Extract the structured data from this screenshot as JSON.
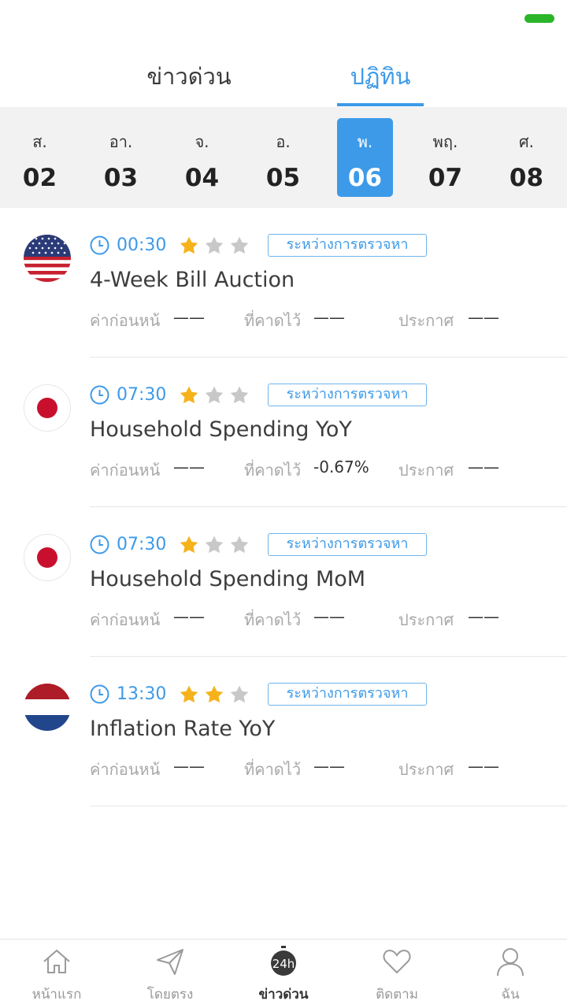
{
  "tabs": [
    {
      "label": "ข่าวด่วน",
      "active": false
    },
    {
      "label": "ปฏิทิน",
      "active": true
    }
  ],
  "days": [
    {
      "dow": "ส.",
      "num": "02"
    },
    {
      "dow": "อา.",
      "num": "03"
    },
    {
      "dow": "จ.",
      "num": "04"
    },
    {
      "dow": "อ.",
      "num": "05"
    },
    {
      "dow": "พ.",
      "num": "06",
      "active": true
    },
    {
      "dow": "พฤ.",
      "num": "07"
    },
    {
      "dow": "ศ.",
      "num": "08"
    }
  ],
  "labels": {
    "previous": "ค่าก่อนหน้",
    "forecast": "ที่คาดไว้",
    "actual": "ประกาศ"
  },
  "events": [
    {
      "flag": "us-flag-icon",
      "time": "00:30",
      "importance": 1,
      "status": "ระหว่างการตรวจหา",
      "title": "4-Week Bill Auction",
      "previous": "——",
      "forecast": "——",
      "actual": "——"
    },
    {
      "flag": "japan-flag-icon",
      "time": "07:30",
      "importance": 1,
      "status": "ระหว่างการตรวจหา",
      "title": "Household Spending YoY",
      "previous": "——",
      "forecast": "-0.67%",
      "actual": "——"
    },
    {
      "flag": "japan-flag-icon",
      "time": "07:30",
      "importance": 1,
      "status": "ระหว่างการตรวจหา",
      "title": "Household Spending MoM",
      "previous": "——",
      "forecast": "——",
      "actual": "——"
    },
    {
      "flag": "netherlands-flag-icon",
      "time": "13:30",
      "importance": 2,
      "status": "ระหว่างการตรวจหา",
      "title": "Inflation Rate YoY",
      "previous": "——",
      "forecast": "——",
      "actual": "——"
    }
  ],
  "bottom_nav": [
    {
      "label": "หน้าแรก",
      "icon": "home-icon"
    },
    {
      "label": "โดยตรง",
      "icon": "send-icon"
    },
    {
      "label": "ข่าวด่วน",
      "icon": "24h-icon",
      "active": true,
      "icon_text": "24h"
    },
    {
      "label": "ติดตาม",
      "icon": "heart-icon"
    },
    {
      "label": "ฉัน",
      "icon": "user-icon"
    }
  ],
  "colors": {
    "accent": "#3d9ae8",
    "star_on": "#f5b21b",
    "star_off": "#c8c8c8",
    "battery": "#2bb52b"
  }
}
